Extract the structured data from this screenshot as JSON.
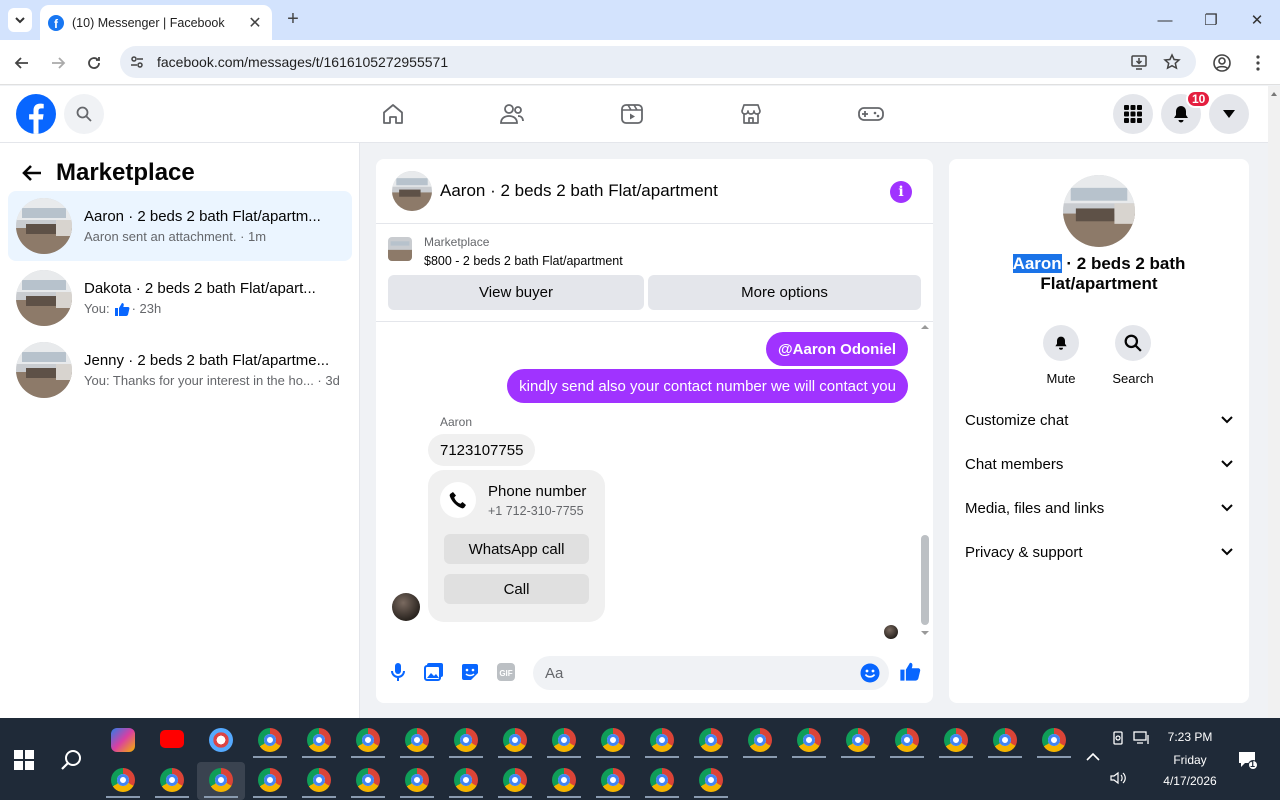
{
  "browser": {
    "tab_title": "(10) Messenger | Facebook",
    "url": "facebook.com/messages/t/1616105272955571"
  },
  "fb": {
    "notification_count": "10"
  },
  "left": {
    "title": "Marketplace",
    "conversations": [
      {
        "name": "Aaron · 2 beds 2 bath Flat/apartm...",
        "preview": "Aaron sent an attachment. · 1m"
      },
      {
        "name": "Dakota · 2 beds 2 bath Flat/apart...",
        "preview_prefix": "You:",
        "preview_suffix": "· 23h"
      },
      {
        "name": "Jenny · 2 beds 2 bath Flat/apartme...",
        "preview": "You: Thanks for your interest in the ho... · 3d"
      }
    ]
  },
  "chat": {
    "header_title": "Aaron · 2 beds 2 bath Flat/apartment",
    "marketplace_label": "Marketplace",
    "listing": "$800 - 2 beds 2 bath Flat/apartment",
    "view_buyer": "View buyer",
    "more_options": "More options",
    "msg_out_1": "@Aaron Odoniel",
    "msg_out_2": "kindly send also your contact number  we will contact you",
    "sender": "Aaron",
    "msg_in_1": "7123107755",
    "phone_title": "Phone number",
    "phone_value": "+1 712-310-7755",
    "whatsapp_call": "WhatsApp call",
    "call": "Call",
    "composer_placeholder": "Aa"
  },
  "right": {
    "name_highlight": "Aaron",
    "name_rest_1": " · 2 beds 2 bath",
    "name_rest_2": "Flat/apartment",
    "mute": "Mute",
    "search": "Search",
    "sections": [
      "Customize chat",
      "Chat members",
      "Media, files and links",
      "Privacy & support"
    ]
  },
  "taskbar": {
    "time": "7:23 PM",
    "day": "Friday",
    "date": "4/17/2026",
    "notif": "1"
  },
  "colors": {
    "accent": "#a033ff",
    "fb_blue": "#0866ff",
    "tab_strip": "#d3e3fd"
  }
}
